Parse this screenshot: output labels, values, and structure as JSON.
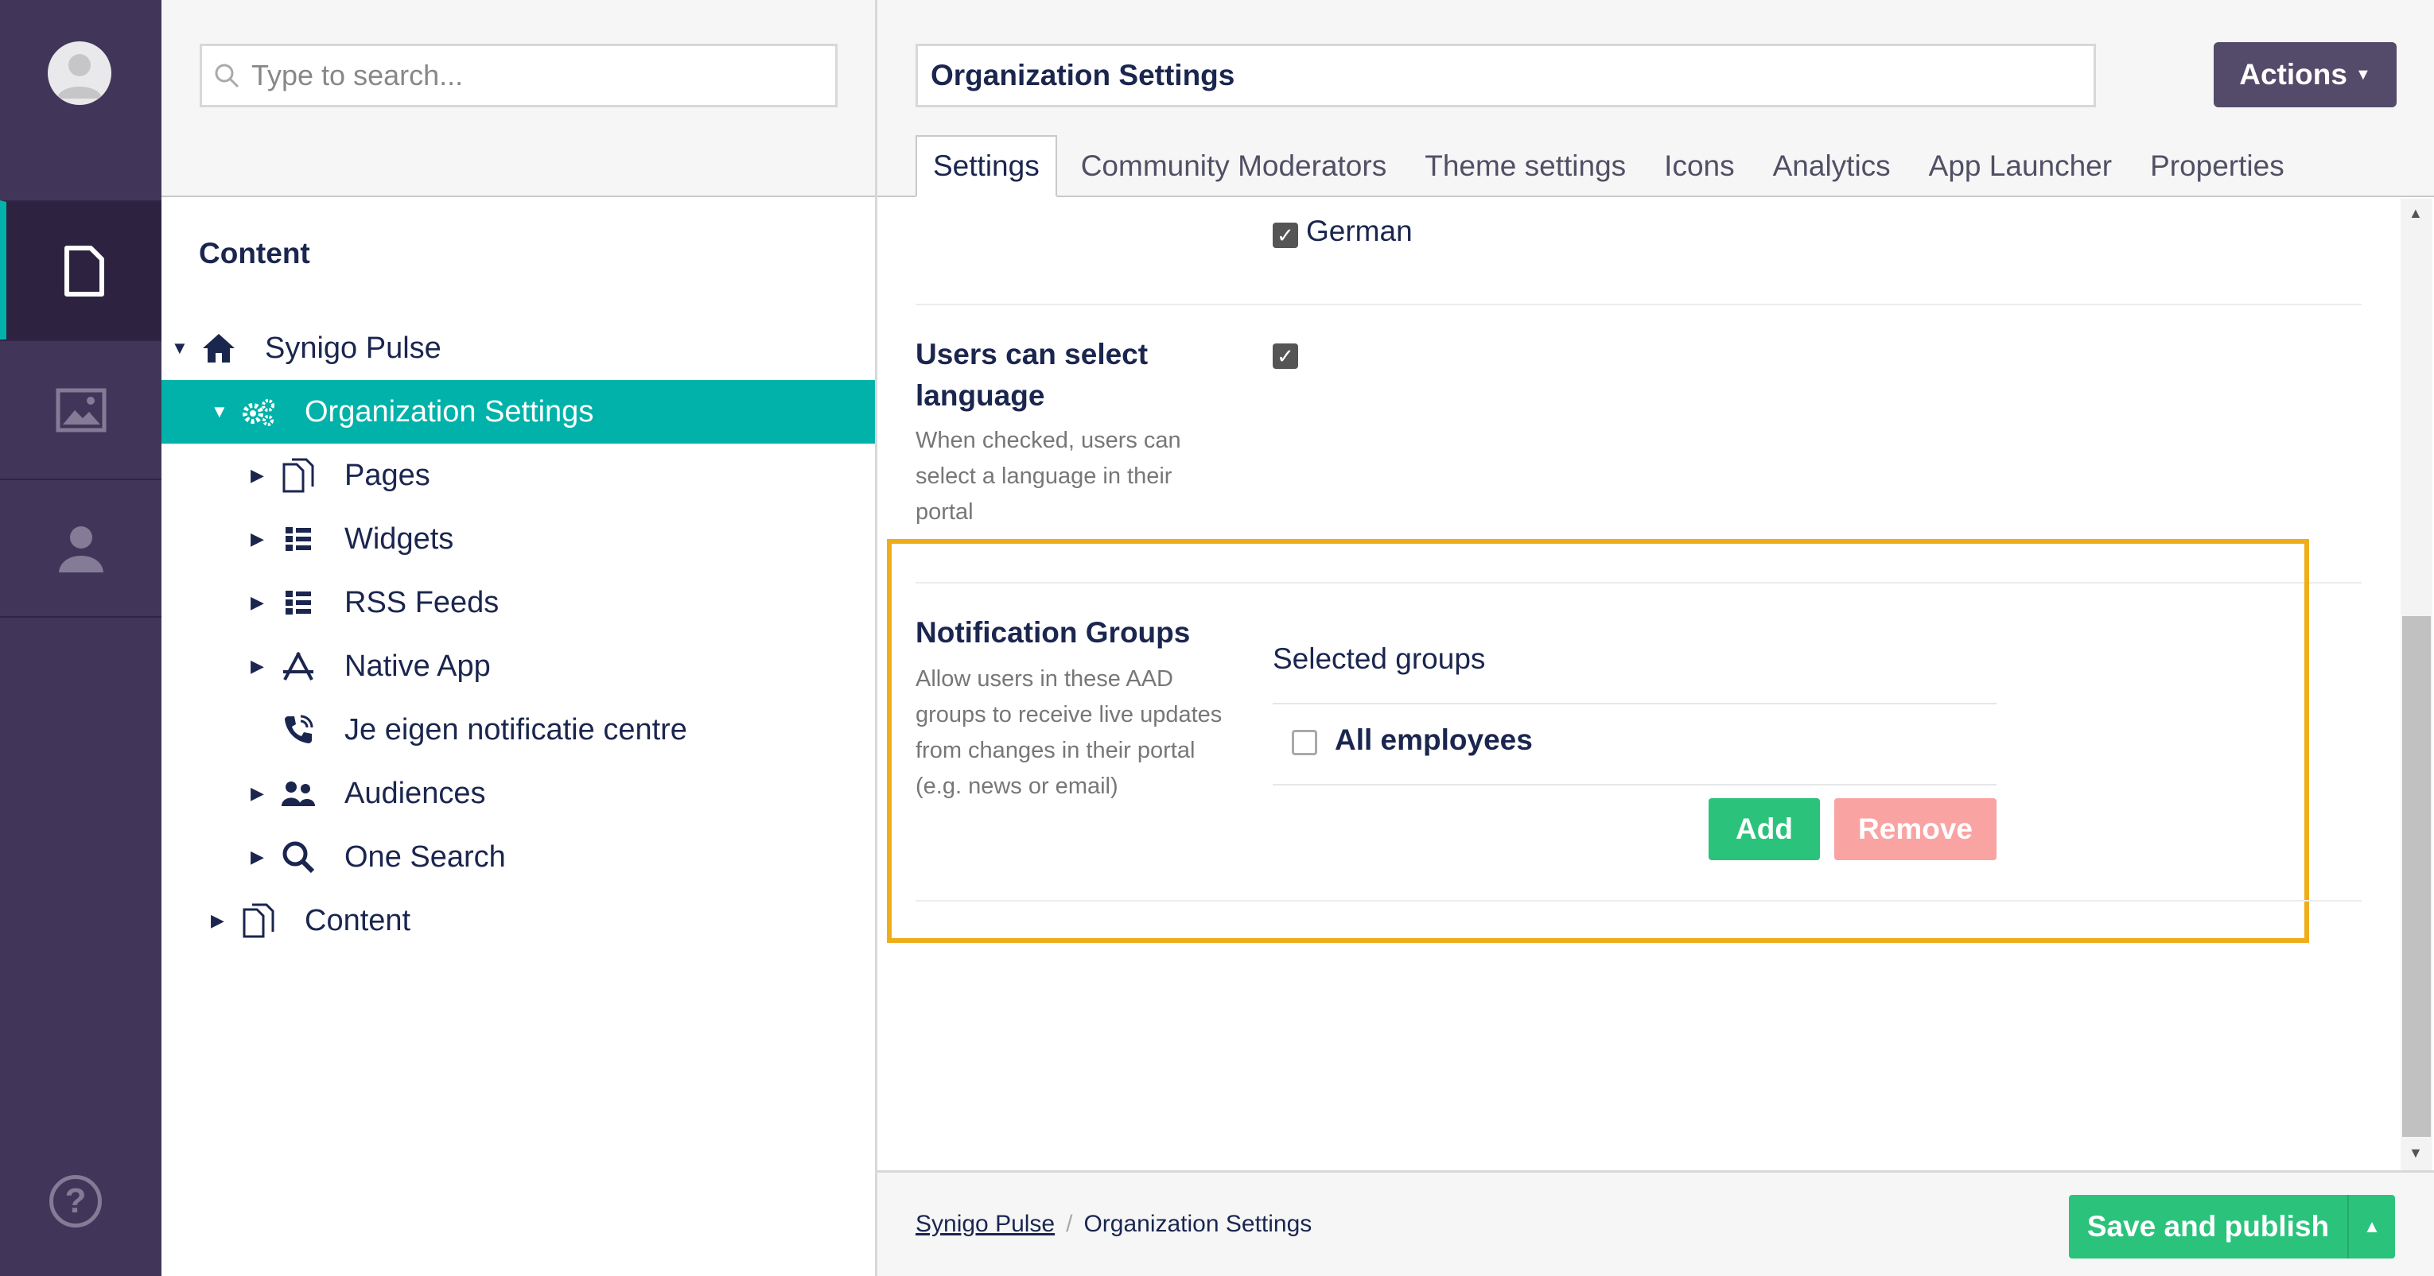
{
  "search": {
    "placeholder": "Type to search..."
  },
  "tree": {
    "title": "Content",
    "items": [
      {
        "label": "Synigo Pulse",
        "icon": "home-icon"
      },
      {
        "label": "Organization Settings",
        "icon": "settings-gears-icon"
      },
      {
        "label": "Pages",
        "icon": "pages-icon"
      },
      {
        "label": "Widgets",
        "icon": "list-icon"
      },
      {
        "label": "RSS Feeds",
        "icon": "list-icon"
      },
      {
        "label": "Native App",
        "icon": "app-store-icon"
      },
      {
        "label": "Je eigen notificatie centre",
        "icon": "phone-ring-icon"
      },
      {
        "label": "Audiences",
        "icon": "users-icon"
      },
      {
        "label": "One Search",
        "icon": "search-icon"
      },
      {
        "label": "Content",
        "icon": "pages-icon"
      }
    ]
  },
  "editor": {
    "name": "Organization Settings",
    "actions_label": "Actions",
    "tabs": [
      "Settings",
      "Community Moderators",
      "Theme settings",
      "Icons",
      "Analytics",
      "App Launcher",
      "Properties"
    ],
    "active_tab": "Settings"
  },
  "settings": {
    "german_label": "German",
    "users_select_language": {
      "label": "Users can select language",
      "description": "When checked, users can select a language in their portal"
    },
    "notification_groups": {
      "label": "Notification Groups",
      "description": "Allow users in these AAD groups to receive live updates from changes in their portal (e.g. news or email)",
      "selected_groups_label": "Selected groups",
      "groups": [
        "All employees"
      ],
      "add_label": "Add",
      "remove_label": "Remove"
    }
  },
  "footer": {
    "breadcrumb": [
      "Synigo Pulse",
      "Organization Settings"
    ],
    "save_label": "Save and publish"
  },
  "colors": {
    "rail": "#413659",
    "accent_teal": "#00b2a9",
    "highlight": "#f0ad1b",
    "success": "#2bc37c",
    "danger_light": "#f9a3a3",
    "actions": "#544a6a"
  }
}
